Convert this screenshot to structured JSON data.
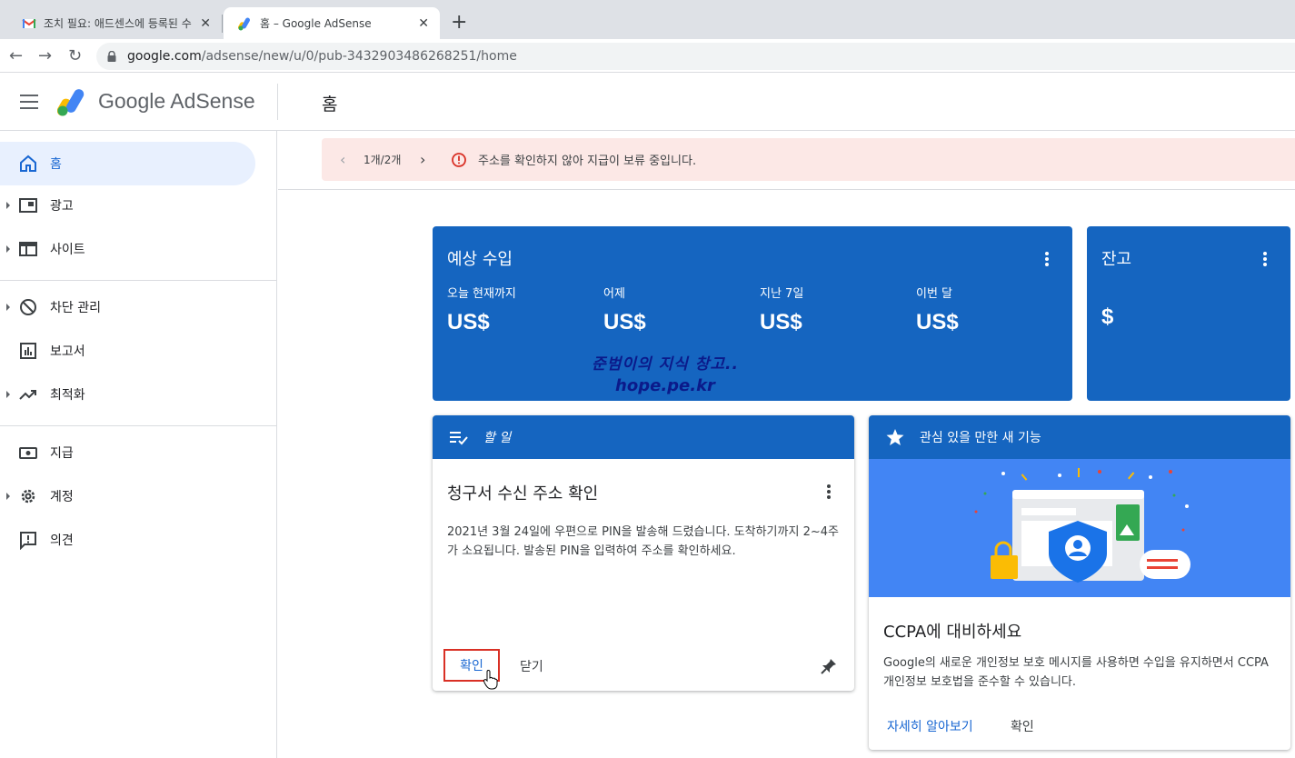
{
  "browser": {
    "tabs": [
      {
        "title": "조치 필요: 애드센스에 등록된 수",
        "close": "✕"
      },
      {
        "title": "홈 – Google AdSense",
        "close": "✕"
      }
    ],
    "new_tab": "+",
    "url_host": "google.com",
    "url_path": "/adsense/new/u/0/pub-3432903486268251/home"
  },
  "header": {
    "brand": "Google AdSense",
    "page_title": "홈"
  },
  "sidebar": {
    "items": [
      {
        "label": "홈"
      },
      {
        "label": "광고"
      },
      {
        "label": "사이트"
      },
      {
        "label": "차단 관리"
      },
      {
        "label": "보고서"
      },
      {
        "label": "최적화"
      },
      {
        "label": "지급"
      },
      {
        "label": "계정"
      },
      {
        "label": "의견"
      }
    ]
  },
  "banner": {
    "prev": "‹",
    "count": "1개/2개",
    "next": "›",
    "message": "주소를 확인하지 않아 지급이 보류 중입니다."
  },
  "earnings": {
    "title": "예상 수입",
    "metrics": [
      {
        "label": "오늘 현재까지",
        "value": "US$"
      },
      {
        "label": "어제",
        "value": "US$"
      },
      {
        "label": "지난 7일",
        "value": "US$"
      },
      {
        "label": "이번 달",
        "value": "US$"
      }
    ],
    "watermark_line1": "준범이의 지식 창고..",
    "watermark_line2": "hope.pe.kr"
  },
  "balance": {
    "title": "잔고",
    "value": "$"
  },
  "todo": {
    "header": "할 일",
    "title": "청구서 수신 주소 확인",
    "body": "2021년 3월 24일에 우편으로 PIN을 발송해 드렸습니다. 도착하기까지 2~4주가 소요됩니다. 발송된 PIN을 입력하여 주소를 확인하세요.",
    "confirm_label": "확인",
    "close_label": "닫기"
  },
  "feature": {
    "header": "관심 있을 만한 새 기능",
    "title": "CCPA에 대비하세요",
    "body": "Google의 새로운 개인정보 보호 메시지를 사용하면 수입을 유지하면서 CCPA 개인정보 보호법을 준수할 수 있습니다.",
    "learn_more": "자세히 알아보기",
    "ok": "확인"
  },
  "colors": {
    "primary_blue": "#1565c0",
    "illustration_blue": "#4285f4",
    "banner_bg": "#fce8e6",
    "error_red": "#d93025",
    "active_nav_bg": "#e8f0fe"
  }
}
